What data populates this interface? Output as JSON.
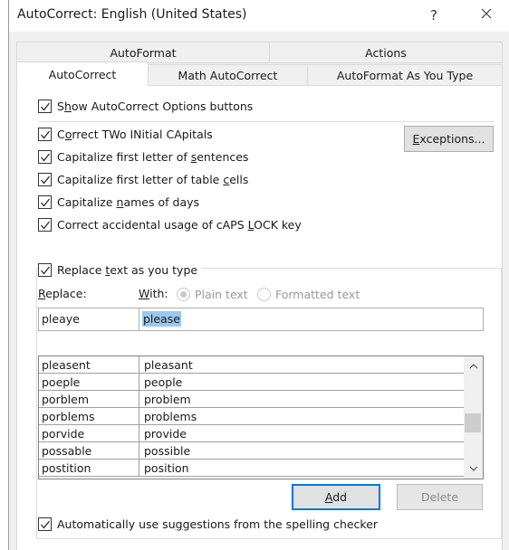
{
  "window": {
    "title": "AutoCorrect: English (United States)",
    "help_label": "?",
    "close_icon": "close-icon"
  },
  "tabs": {
    "row_back": [
      {
        "label": "AutoFormat"
      },
      {
        "label": "Actions"
      }
    ],
    "row_front": [
      {
        "label": "AutoCorrect",
        "active": true
      },
      {
        "label": "Math AutoCorrect",
        "active": false
      },
      {
        "label": "AutoFormat As You Type",
        "active": false
      }
    ]
  },
  "options": {
    "show_buttons": {
      "pre": "S",
      "key": "h",
      "post": "ow AutoCorrect Options buttons",
      "checked": true
    },
    "items": [
      {
        "pre": "C",
        "key": "o",
        "post": "rrect TWo INitial CApitals",
        "checked": true
      },
      {
        "pre": "Capitalize first letter of ",
        "key": "s",
        "post": "entences",
        "checked": true
      },
      {
        "pre": "Capitalize first letter of table ",
        "key": "c",
        "post": "ells",
        "checked": true
      },
      {
        "pre": "Capitalize ",
        "key": "n",
        "post": "ames of days",
        "checked": true
      },
      {
        "pre": "Correct accidental usage of cAPS ",
        "key": "L",
        "post": "OCK key",
        "checked": true
      }
    ],
    "exceptions_button": {
      "key": "E",
      "post": "xceptions..."
    }
  },
  "replace_group": {
    "checkbox": {
      "pre": "Replace ",
      "key": "t",
      "post": "ext as you type",
      "checked": true
    },
    "replace_label": {
      "key": "R",
      "post": "eplace:"
    },
    "with_label": {
      "key": "W",
      "post": "ith:"
    },
    "radio_plain": {
      "label": "Plain text",
      "selected": true,
      "enabled": false
    },
    "radio_formatted": {
      "label": "Formatted text",
      "selected": false,
      "enabled": false
    },
    "replace_value": "pleaye",
    "with_value": "please",
    "entries": [
      {
        "replace": "pleasent",
        "with": "pleasant"
      },
      {
        "replace": "poeple",
        "with": "people"
      },
      {
        "replace": "porblem",
        "with": "problem"
      },
      {
        "replace": "porblems",
        "with": "problems"
      },
      {
        "replace": "porvide",
        "with": "provide"
      },
      {
        "replace": "possable",
        "with": "possible"
      },
      {
        "replace": "postition",
        "with": "position"
      }
    ],
    "scroll_position_fraction": 0.58,
    "add_button": {
      "key": "A",
      "post": "dd"
    },
    "delete_button": {
      "label": "Delete",
      "enabled": false
    },
    "auto_suggest": {
      "pre": "Automatically use su",
      "key": "g",
      "post": "gestions from the spelling checker",
      "checked": true
    }
  }
}
